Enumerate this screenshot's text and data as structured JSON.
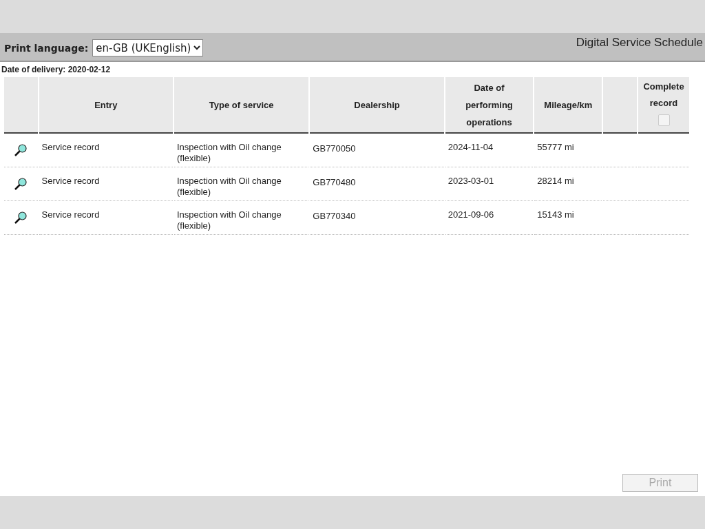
{
  "header": {
    "print_language_label": "Print language:",
    "print_language_value": "en-GB (UKEnglish)",
    "title": "Digital Service Schedule"
  },
  "date_of_delivery": "Date of delivery: 2020-02-12",
  "table": {
    "columns": [
      "Entry",
      "Type of service",
      "Dealership",
      "Date of performing operations",
      "Mileage/km",
      "Complete record"
    ],
    "complete_record_checked": false,
    "rows": [
      {
        "entry": "Service record",
        "type_line1": "Inspection with Oil change",
        "type_line2": "(flexible)",
        "dealership": "GB770050",
        "date": "2024-11-04",
        "mileage": "55777 mi"
      },
      {
        "entry": "Service record",
        "type_line1": "Inspection with Oil change",
        "type_line2": "(flexible)",
        "dealership": "GB770480",
        "date": "2023-03-01",
        "mileage": "28214 mi"
      },
      {
        "entry": "Service record",
        "type_line1": "Inspection with Oil change",
        "type_line2": "(flexible)",
        "dealership": "GB770340",
        "date": "2021-09-06",
        "mileage": "15143 mi"
      }
    ]
  },
  "print_button": {
    "label": "Print",
    "disabled": true
  }
}
